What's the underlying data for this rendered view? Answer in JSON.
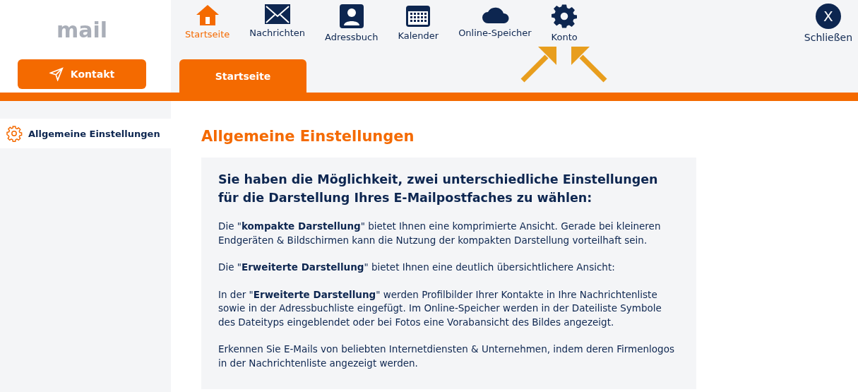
{
  "logo": {
    "text": "mail"
  },
  "contact_button": {
    "label": "Kontakt"
  },
  "nav": [
    {
      "kind": "home",
      "label": "Startseite",
      "selected": true
    },
    {
      "kind": "mail",
      "label": "Nachrichten",
      "selected": false
    },
    {
      "kind": "contacts",
      "label": "Adressbuch",
      "selected": false
    },
    {
      "kind": "calendar",
      "label": "Kalender",
      "selected": false
    },
    {
      "kind": "cloud",
      "label": "Online-Speicher",
      "selected": false
    },
    {
      "kind": "settings",
      "label": "Konto",
      "selected": false
    }
  ],
  "close": {
    "icon": "X",
    "label": "Schließen"
  },
  "tab": {
    "label": "Startseite",
    "selected": true
  },
  "sidebar": {
    "items": [
      {
        "label": "Allgemeine Einstellungen",
        "selected": true
      }
    ]
  },
  "main": {
    "title": "Allgemeine Einstellungen",
    "intro": "Sie haben die Möglichkeit, zwei unterschiedliche Einstellungen für die Darstellung Ihres E-Mailpostfaches zu wählen:",
    "paragraphs": [
      "Die \"**kompakte Darstellung**\" bietet Ihnen eine komprimierte Ansicht. Gerade bei kleineren Endgeräten & Bildschirmen kann die Nutzung der kompakten Darstellung vorteilhaft sein.",
      "Die \"**Erweiterte Darstellung**\" bietet Ihnen eine deutlich übersichtlichere Ansicht:",
      "In der \"**Erweiterte Darstellung**\" werden Profilbilder Ihrer Kontakte in Ihre Nachrichtenliste sowie in der Adressbuchliste eingefügt. Im Online-Speicher werden in der Dateiliste Symbole des Dateityps eingeblendet oder bei Fotos eine Vorabansicht des Bildes angezeigt.",
      "Erkennen Sie E-Mails von beliebten Internetdiensten & Unternehmen, indem deren Firmenlogos in der Nachrichtenliste angezeigt werden."
    ]
  }
}
